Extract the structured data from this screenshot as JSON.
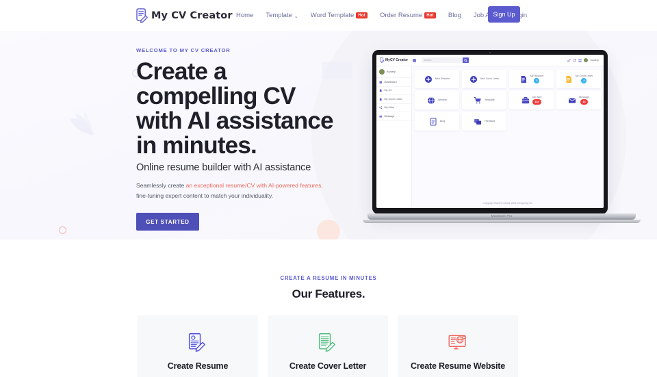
{
  "navbar": {
    "logo_text": "My CV Creator",
    "logo_icon": "resume-pencil-icon",
    "links": [
      {
        "label": "Home",
        "badge": "",
        "caret": false
      },
      {
        "label": "Template",
        "badge": "",
        "caret": true
      },
      {
        "label": "Word Template",
        "badge": "Hot",
        "caret": false
      },
      {
        "label": "Order Resume",
        "badge": "Hot",
        "caret": false
      },
      {
        "label": "Blog",
        "badge": "",
        "caret": false
      },
      {
        "label": "Job Alert",
        "badge": "",
        "caret": false
      },
      {
        "label": "Login",
        "badge": "",
        "caret": false
      }
    ],
    "signup_label": "Sign Up",
    "caret_glyph": "⌄"
  },
  "hero": {
    "eyebrow": "WELCOME TO MY CV CREATOR",
    "headline": "Create a compelling CV with AI assistance in minutes.",
    "subhead": "Online resume builder with AI assistance",
    "lede_before": "Seamlessly create ",
    "lede_accent": "an exceptional resume/CV with AI-powered features,",
    "lede_after": " fine-tuning expert content to match your individuality.",
    "cta_label": "GET STARTED",
    "close_glyph": "✕"
  },
  "mockup": {
    "brand": "MyCV Creator",
    "search_placeholder": "Search",
    "search_icon": "search-icon",
    "topbar_icons": [
      "chart-icon",
      "bell-icon",
      "grid-icon"
    ],
    "account_name": "Kunlery",
    "sidebar_user": "Kunlery",
    "sidebar_items": [
      {
        "label": "Dashboard",
        "icon": "dashboard-icon"
      },
      {
        "label": "My CV",
        "icon": "document-icon"
      },
      {
        "label": "My Cover Letter",
        "icon": "document-icon"
      },
      {
        "label": "My Links",
        "icon": "share-icon"
      },
      {
        "label": "Message",
        "icon": "mail-icon"
      }
    ],
    "cards": [
      {
        "label": "New Resume",
        "icon": "plus-circle-icon",
        "badge": "",
        "badge_style": ""
      },
      {
        "label": "New Cover Letter",
        "icon": "plus-circle-icon",
        "badge": "",
        "badge_style": ""
      },
      {
        "label": "My Resume",
        "icon": "file-blue-icon",
        "badge": "3",
        "badge_style": "blue"
      },
      {
        "label": "My Cover Letter",
        "icon": "file-yellow-icon",
        "badge": "4",
        "badge_style": "blue"
      },
      {
        "label": "Website",
        "icon": "globe-icon",
        "badge": "",
        "badge_style": ""
      },
      {
        "label": "Template",
        "icon": "cart-icon",
        "badge": "",
        "badge_style": ""
      },
      {
        "label": "Job Alert",
        "icon": "briefcase-icon",
        "badge": "134",
        "badge_style": "red"
      },
      {
        "label": "Message",
        "icon": "envelope-icon",
        "badge": "14",
        "badge_style": "red"
      },
      {
        "label": "Blog",
        "icon": "notes-icon",
        "badge": "",
        "badge_style": ""
      },
      {
        "label": "Feedback",
        "icon": "chat-icon",
        "badge": "",
        "badge_style": ""
      }
    ],
    "footer": "Copyright ©MyCV Creator 2020. Design By CIL",
    "device_label": "MacBook Pro"
  },
  "features": {
    "eyebrow": "CREATE A RESUME IN MINUTES",
    "title": "Our Features.",
    "cards": [
      {
        "label": "Create Resume",
        "icon": "resume-pencil-icon",
        "color": "#4e4ee0"
      },
      {
        "label": "Create Cover Letter",
        "icon": "letter-pencil-icon",
        "color": "#4fbd7e"
      },
      {
        "label": "Create Resume Website",
        "icon": "monitor-globe-icon",
        "color": "#f1685e"
      }
    ]
  },
  "colors": {
    "brand_purple": "#5b5bcf",
    "cta_purple": "#4f4fb8",
    "accent_red": "#f2685e",
    "hot_red": "#e8362c",
    "teal": "#6fe0cf"
  }
}
